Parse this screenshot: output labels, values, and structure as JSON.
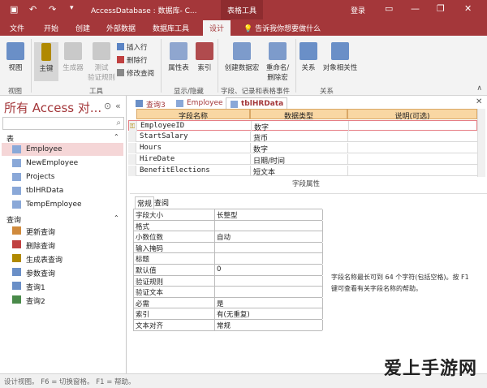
{
  "window": {
    "title": "AccessDatabase : 数据库- C...",
    "context_tab": "表格工具",
    "login": "登录"
  },
  "tabs": [
    {
      "label": "文件"
    },
    {
      "label": "开始"
    },
    {
      "label": "创建"
    },
    {
      "label": "外部数据"
    },
    {
      "label": "数据库工具"
    },
    {
      "label": "设计"
    }
  ],
  "tellme": "告诉我你想要做什么",
  "ribbon": {
    "view": "视图",
    "primary_key": "主键",
    "builder": "生成器",
    "test_rules": "测试",
    "test_rules2": "验证规则",
    "insert_rows": "插入行",
    "delete_rows": "删除行",
    "modify_lookups": "修改查阅",
    "property_sheet": "属性表",
    "indexes": "索引",
    "create_macros": "创建数据宏",
    "rename_macro": "重命名/",
    "rename_macro2": "删除宏",
    "relationships": "关系",
    "object_dependencies": "对象相关性",
    "groups": {
      "views": "视图",
      "tools": "工具",
      "show_hide": "显示/隐藏",
      "field_events": "字段、记录和表格事件",
      "relationships": "关系"
    }
  },
  "nav": {
    "title": "所有 Access 对...",
    "sections": [
      {
        "label": "表"
      },
      {
        "label": "查询"
      }
    ],
    "tables": [
      {
        "label": "Employee"
      },
      {
        "label": "NewEmployee"
      },
      {
        "label": "Projects"
      },
      {
        "label": "tblHRData"
      },
      {
        "label": "TempEmployee"
      }
    ],
    "queries": [
      {
        "label": "更新查询"
      },
      {
        "label": "删除查询"
      },
      {
        "label": "生成表查询"
      },
      {
        "label": "参数查询"
      },
      {
        "label": "查询1"
      },
      {
        "label": "查询2"
      }
    ]
  },
  "doc_tabs": [
    {
      "label": "查询3"
    },
    {
      "label": "Employee"
    },
    {
      "label": "tblHRData"
    }
  ],
  "grid": {
    "headers": {
      "field_name": "字段名称",
      "data_type": "数据类型",
      "description": "说明(可选)"
    },
    "rows": [
      {
        "field": "EmployeeID",
        "type": "数字"
      },
      {
        "field": "StartSalary",
        "type": "货币"
      },
      {
        "field": "Hours",
        "type": "数字"
      },
      {
        "field": "HireDate",
        "type": "日期/时间"
      },
      {
        "field": "BenefitElections",
        "type": "短文本"
      }
    ]
  },
  "field_props": {
    "title": "字段属性",
    "tabs": [
      {
        "label": "常规"
      },
      {
        "label": "查阅"
      }
    ],
    "rows": [
      {
        "label": "字段大小",
        "value": "长整型"
      },
      {
        "label": "格式",
        "value": ""
      },
      {
        "label": "小数位数",
        "value": "自动"
      },
      {
        "label": "输入掩码",
        "value": ""
      },
      {
        "label": "标题",
        "value": ""
      },
      {
        "label": "默认值",
        "value": "0"
      },
      {
        "label": "验证规则",
        "value": ""
      },
      {
        "label": "验证文本",
        "value": ""
      },
      {
        "label": "必需",
        "value": "是"
      },
      {
        "label": "索引",
        "value": "有(无重复)"
      },
      {
        "label": "文本对齐",
        "value": "常规"
      }
    ],
    "hint": "字段名称最长可到 64 个字符(包括空格)。按 F1 键可查看有关字段名称的帮助。"
  },
  "status": "设计视图。 F6 = 切换窗格。 F1 = 帮助。",
  "watermark": "爱上手游网",
  "colors": {
    "accent": "#a4373a",
    "header": "#f9d7a3",
    "selected": "#f5d6d7"
  }
}
